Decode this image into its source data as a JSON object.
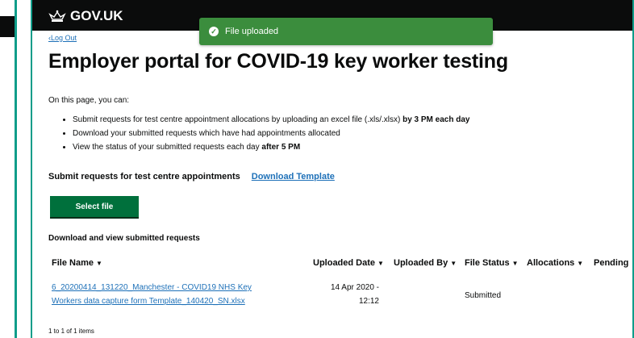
{
  "header": {
    "logo_text": "GOV.UK",
    "logout_label": "Log Out"
  },
  "toast": {
    "message": "File uploaded"
  },
  "page": {
    "title": "Employer portal for COVID-19 key worker testing",
    "intro": "On this page, you can:"
  },
  "bullets": [
    {
      "text": "Submit requests for test centre appointment allocations by uploading an excel file (.xls/.xlsx) ",
      "strong": "by 3 PM each day"
    },
    {
      "text": "Download your submitted requests which have had appointments allocated",
      "strong": ""
    },
    {
      "text": "View the status of your submitted requests each day ",
      "strong": "after 5 PM"
    }
  ],
  "submit": {
    "label": "Submit requests for test centre appointments",
    "template_link": "Download Template",
    "select_button": "Select file"
  },
  "table": {
    "heading": "Download and view submitted requests",
    "columns": [
      "File Name",
      "Uploaded Date",
      "Uploaded By",
      "File Status",
      "Allocations",
      "Pending"
    ],
    "rows": [
      {
        "file_name_line1": "6_20200414_131220_Manchester - COVID19 NHS Key",
        "file_name_line2": "Workers data capture form Template_140420_SN.xlsx",
        "uploaded_date_line1": "14 Apr 2020 -",
        "uploaded_date_line2": "12:12",
        "uploaded_by": "",
        "file_status": "Submitted"
      }
    ],
    "pager": "1 to 1 of 1 items"
  },
  "colors": {
    "header_bg": "#0b0c0c",
    "toast_bg": "#3b8d3d",
    "button_bg": "#00703c",
    "link": "#1d70b8",
    "frame": "#0f9d8a"
  }
}
